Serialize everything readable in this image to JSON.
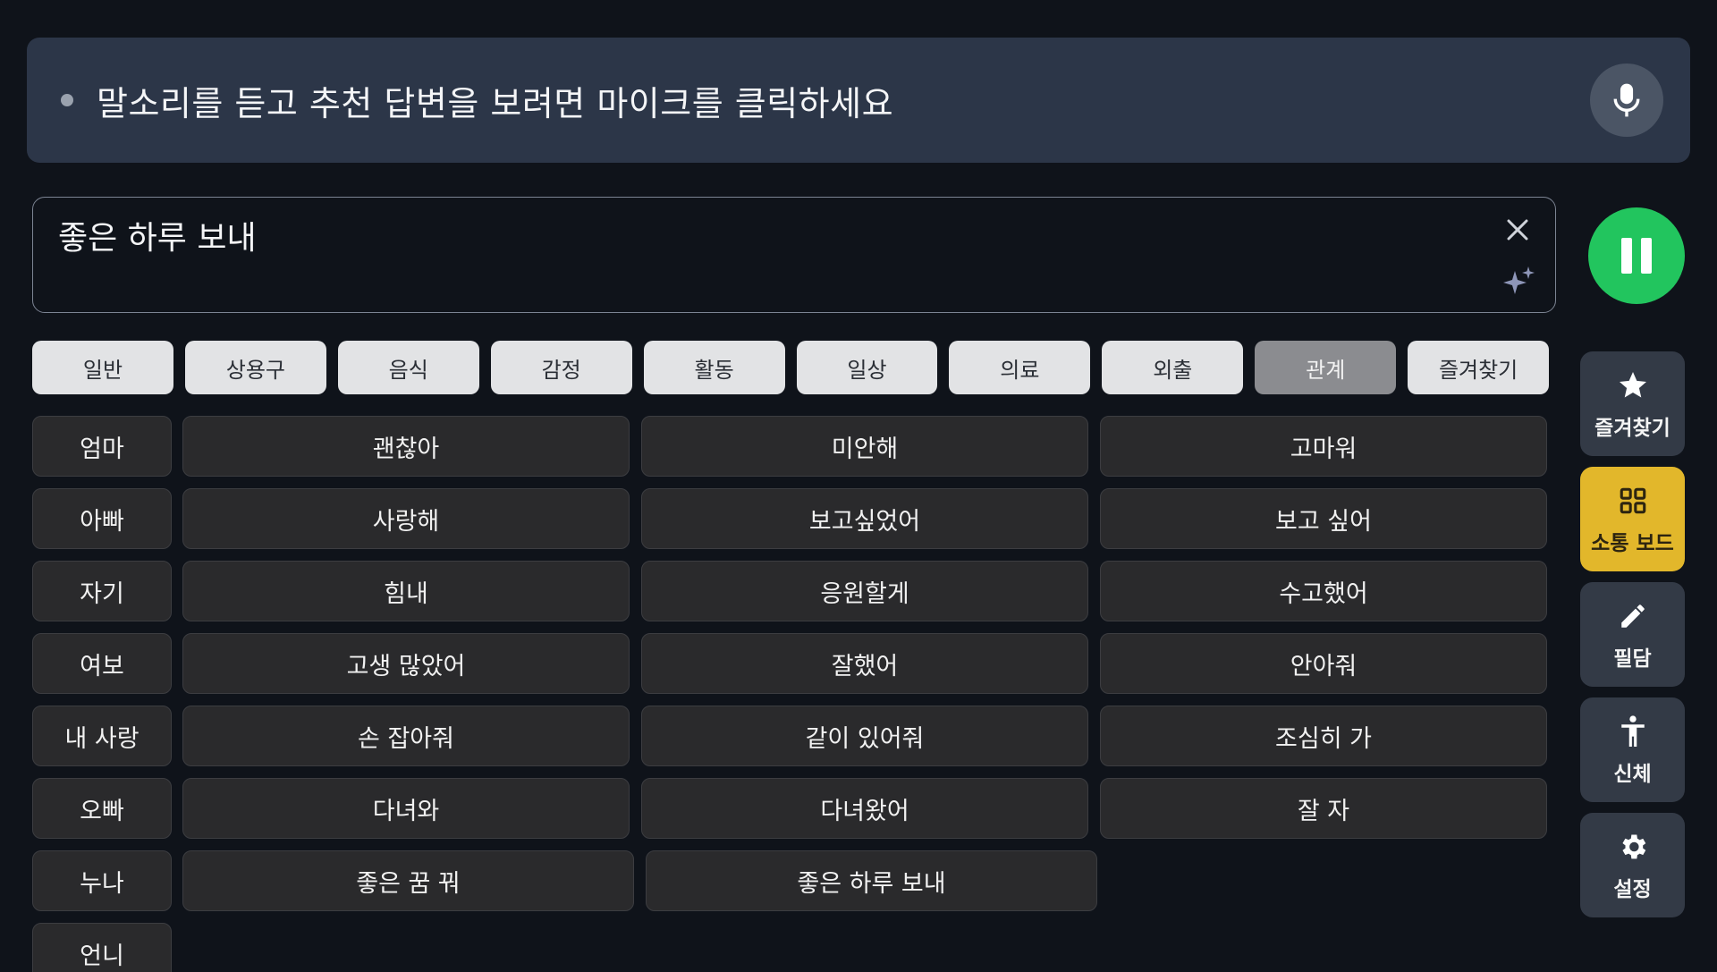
{
  "banner": {
    "message": "말소리를 듣고 추천 답변을 보려면 마이크를 클릭하세요"
  },
  "input": {
    "value": "좋은 하루 보내"
  },
  "tabs": [
    {
      "label": "일반"
    },
    {
      "label": "상용구"
    },
    {
      "label": "음식"
    },
    {
      "label": "감정"
    },
    {
      "label": "활동"
    },
    {
      "label": "일상"
    },
    {
      "label": "의료"
    },
    {
      "label": "외출"
    },
    {
      "label": "관계",
      "active": true
    },
    {
      "label": "즐겨찾기"
    }
  ],
  "people": [
    "엄마",
    "아빠",
    "자기",
    "여보",
    "내 사랑",
    "오빠",
    "누나",
    "언니"
  ],
  "phrases": [
    [
      "괜찮아",
      "미안해",
      "고마워"
    ],
    [
      "사랑해",
      "보고싶었어",
      "보고 싶어"
    ],
    [
      "힘내",
      "응원할게",
      "수고했어"
    ],
    [
      "고생 많았어",
      "잘했어",
      "안아줘"
    ],
    [
      "손 잡아줘",
      "같이 있어줘",
      "조심히 가"
    ],
    [
      "다녀와",
      "다녀왔어",
      "잘 자"
    ],
    [
      "좋은 꿈 꿔",
      "좋은 하루 보내"
    ]
  ],
  "sidenav": [
    {
      "label": "즐겨찾기",
      "icon": "star-icon"
    },
    {
      "label": "소통 보드",
      "icon": "grid-icon",
      "active": true
    },
    {
      "label": "필담",
      "icon": "pencil-icon"
    },
    {
      "label": "신체",
      "icon": "body-icon"
    },
    {
      "label": "설정",
      "icon": "gear-icon"
    }
  ],
  "colors": {
    "background": "#0f131a",
    "banner": "#2c3648",
    "pause_button": "#22c55e",
    "active_nav": "#e2b72b",
    "active_tab": "#8b8c90"
  }
}
